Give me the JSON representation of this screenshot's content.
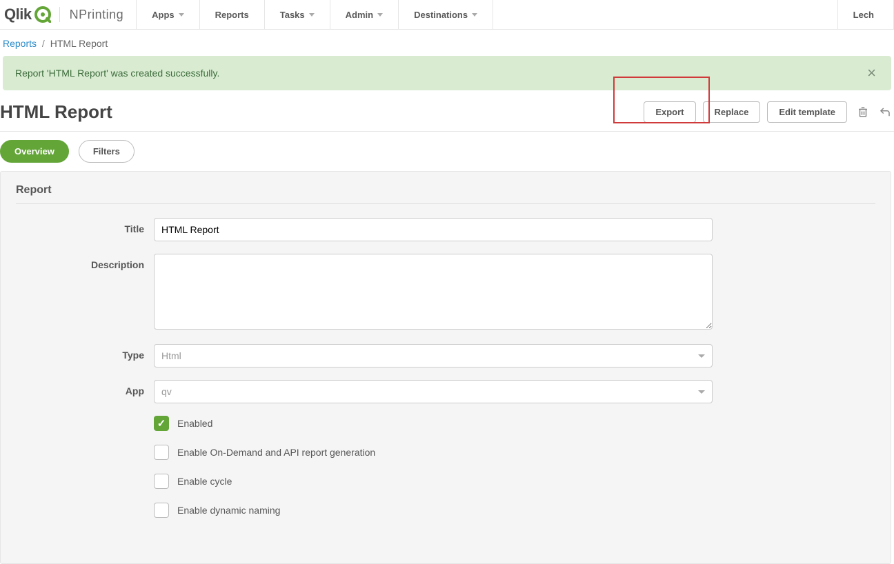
{
  "brand": {
    "qlik": "Qlik",
    "nprinting": "NPrinting"
  },
  "nav": {
    "items": [
      {
        "label": "Apps",
        "dropdown": true
      },
      {
        "label": "Reports",
        "dropdown": false
      },
      {
        "label": "Tasks",
        "dropdown": true
      },
      {
        "label": "Admin",
        "dropdown": true
      },
      {
        "label": "Destinations",
        "dropdown": true
      }
    ],
    "user": "Lech"
  },
  "breadcrumb": {
    "parent": "Reports",
    "current": "HTML Report"
  },
  "alert": {
    "message": "Report 'HTML Report' was created successfully."
  },
  "header": {
    "title": "HTML Report",
    "buttons": {
      "export": "Export",
      "replace": "Replace",
      "edit_template": "Edit template"
    }
  },
  "tabs": {
    "overview": "Overview",
    "filters": "Filters"
  },
  "panel": {
    "heading": "Report",
    "fields": {
      "title_label": "Title",
      "title_value": "HTML Report",
      "description_label": "Description",
      "description_value": "",
      "type_label": "Type",
      "type_value": "Html",
      "app_label": "App",
      "app_value": "qv"
    },
    "checks": {
      "enabled": "Enabled",
      "ondemand": "Enable On-Demand and API report generation",
      "cycle": "Enable cycle",
      "dynamic": "Enable dynamic naming"
    }
  }
}
